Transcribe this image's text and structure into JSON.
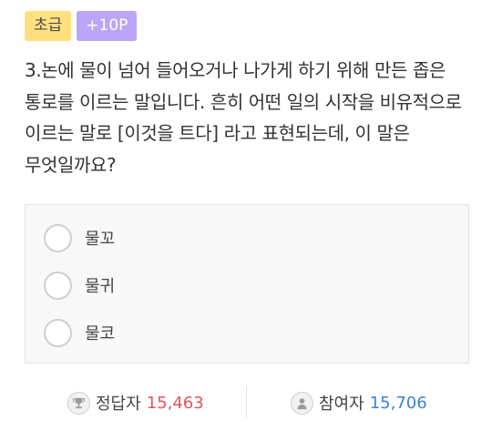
{
  "badges": {
    "level": "초급",
    "points": "+10P"
  },
  "question": {
    "text": "3.논에 물이 넘어 들어오거나 나가게 하기 위해 만든 좁은 통로를 이르는 말입니다. 흔히 어떤 일의 시작을 비유적으로 이르는 말로 [이것을 트다] 라고 표현되는데, 이 말은 무엇일까요?"
  },
  "options": [
    {
      "label": "물꼬"
    },
    {
      "label": "물귀"
    },
    {
      "label": "물코"
    }
  ],
  "stats": {
    "correct_label": "정답자",
    "correct_value": "15,463",
    "participants_label": "참여자",
    "participants_value": "15,706",
    "correct_icon": "trophy-icon",
    "participants_icon": "person-icon"
  },
  "colors": {
    "level_badge": "#ffe07f",
    "points_badge": "#b9a6f6",
    "correct_value": "#e8515e",
    "participants_value": "#3b7fd4"
  }
}
